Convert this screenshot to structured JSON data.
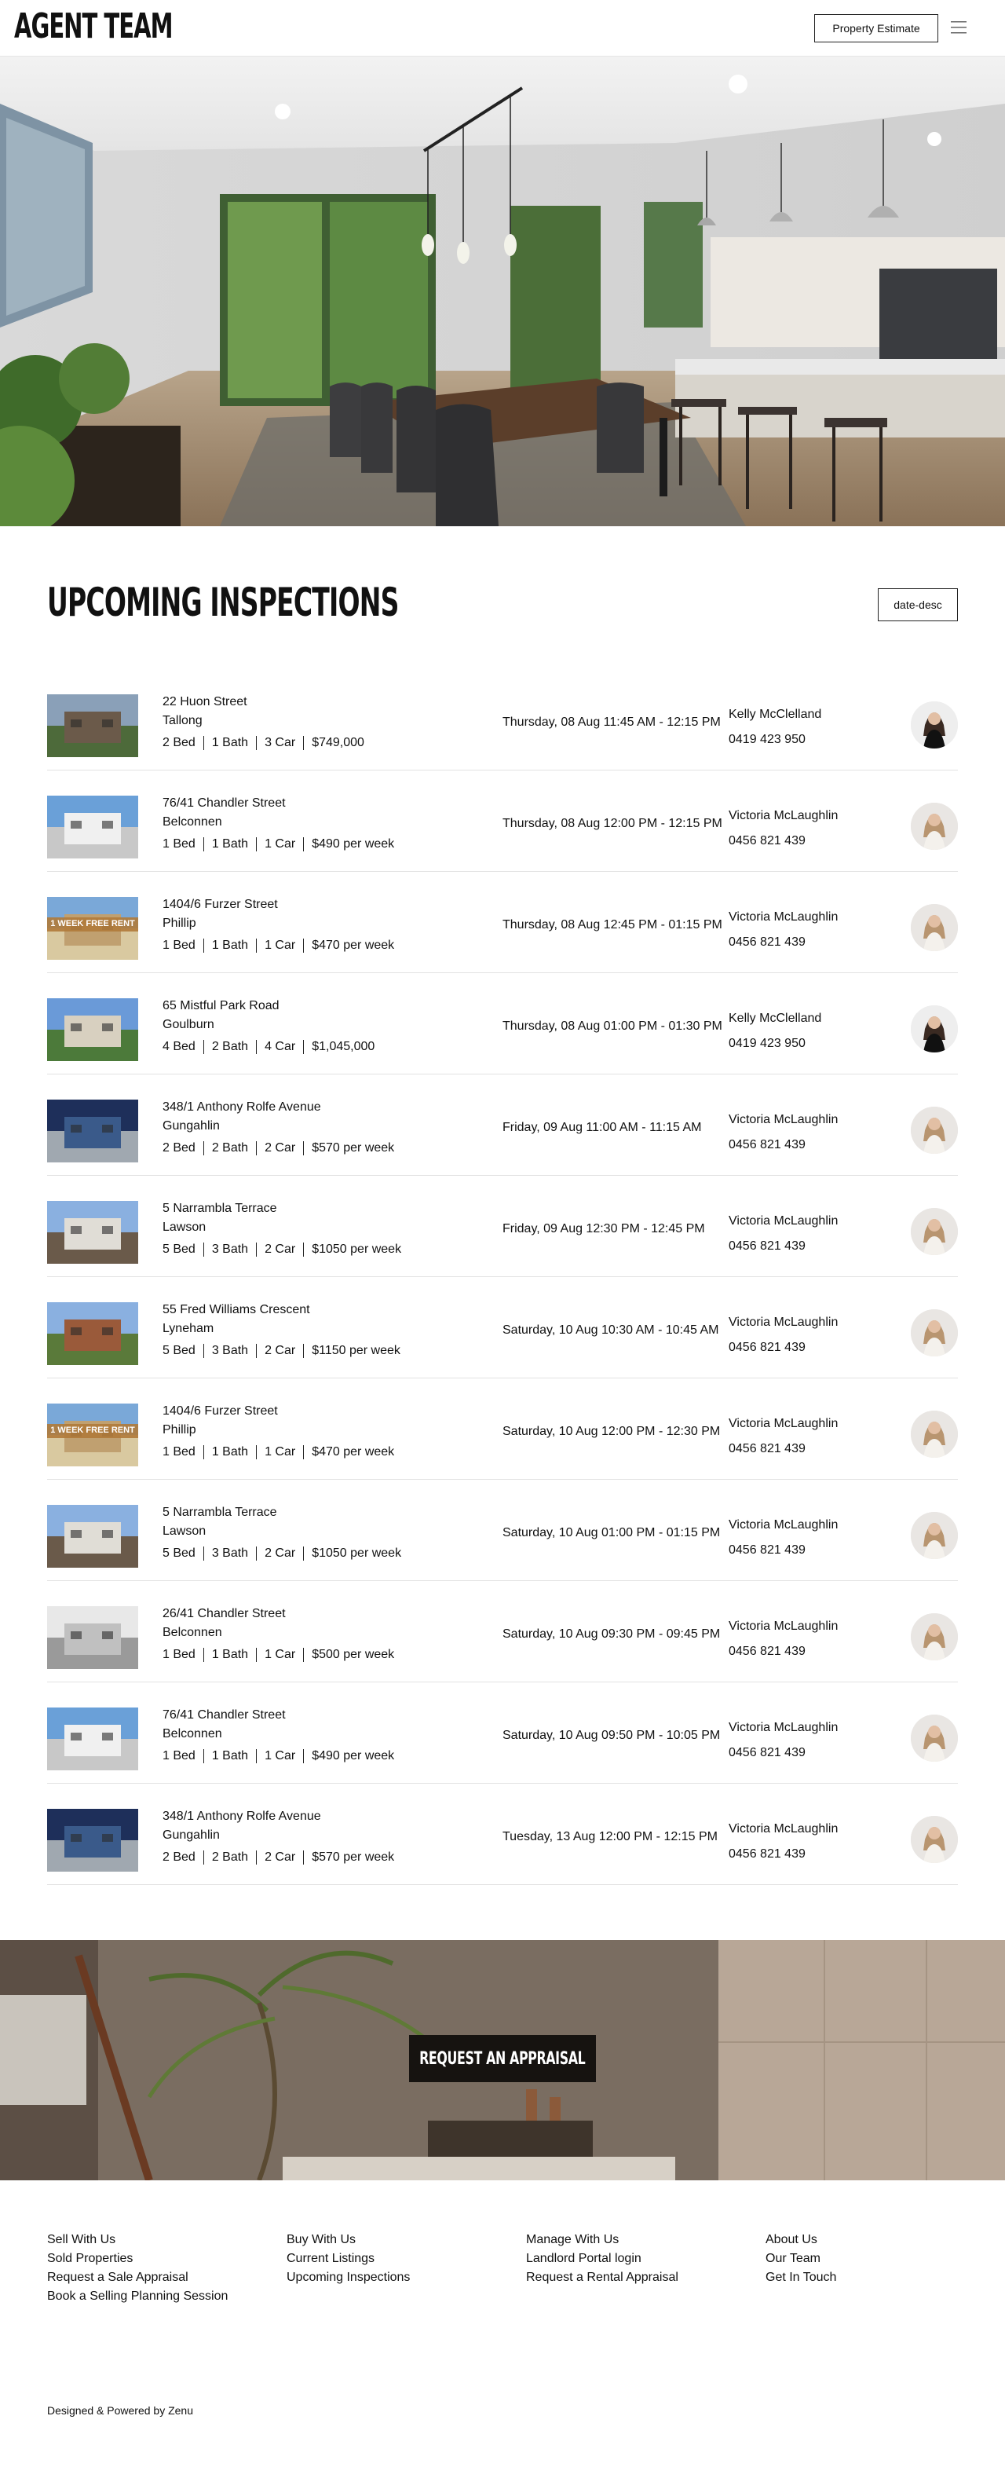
{
  "header": {
    "logo": "AGENT TEAM",
    "estimate_label": "Property Estimate"
  },
  "inspections": {
    "title": "UPCOMING INSPECTIONS",
    "sort_value": "date-desc",
    "rows": [
      {
        "street": "22 Huon Street",
        "suburb": "Tallong",
        "bed": "2 Bed",
        "bath": "1 Bath",
        "car": "3 Car",
        "price": "$749,000",
        "time": "Thursday, 08 Aug 11:45 AM - 12:15 PM",
        "agent": "Kelly McClelland",
        "phone": "0419 423 950"
      },
      {
        "street": "76/41 Chandler Street",
        "suburb": "Belconnen",
        "bed": "1 Bed",
        "bath": "1 Bath",
        "car": "1 Car",
        "price": "$490 per week",
        "time": "Thursday, 08 Aug 12:00 PM - 12:15 PM",
        "agent": "Victoria McLaughlin",
        "phone": "0456 821 439"
      },
      {
        "street": "1404/6 Furzer Street",
        "suburb": "Phillip",
        "bed": "1 Bed",
        "bath": "1 Bath",
        "car": "1 Car",
        "price": "$470 per week",
        "time": "Thursday, 08 Aug 12:45 PM - 01:15 PM",
        "agent": "Victoria McLaughlin",
        "phone": "0456 821 439",
        "banner": "1 WEEK FREE RENT"
      },
      {
        "street": "65 Mistful Park Road",
        "suburb": "Goulburn",
        "bed": "4 Bed",
        "bath": "2 Bath",
        "car": "4 Car",
        "price": "$1,045,000",
        "time": "Thursday, 08 Aug 01:00 PM - 01:30 PM",
        "agent": "Kelly McClelland",
        "phone": "0419 423 950"
      },
      {
        "street": "348/1 Anthony Rolfe Avenue",
        "suburb": "Gungahlin",
        "bed": "2 Bed",
        "bath": "2 Bath",
        "car": "2 Car",
        "price": "$570 per week",
        "time": "Friday, 09 Aug 11:00 AM - 11:15 AM",
        "agent": "Victoria McLaughlin",
        "phone": "0456 821 439"
      },
      {
        "street": "5 Narrambla Terrace",
        "suburb": "Lawson",
        "bed": "5 Bed",
        "bath": "3 Bath",
        "car": "2 Car",
        "price": "$1050 per week",
        "time": "Friday, 09 Aug 12:30 PM - 12:45 PM",
        "agent": "Victoria McLaughlin",
        "phone": "0456 821 439"
      },
      {
        "street": "55 Fred Williams Crescent",
        "suburb": "Lyneham",
        "bed": "5 Bed",
        "bath": "3 Bath",
        "car": "2 Car",
        "price": "$1150 per week",
        "time": "Saturday, 10 Aug 10:30 AM - 10:45 AM",
        "agent": "Victoria McLaughlin",
        "phone": "0456 821 439"
      },
      {
        "street": "1404/6 Furzer Street",
        "suburb": "Phillip",
        "bed": "1 Bed",
        "bath": "1 Bath",
        "car": "1 Car",
        "price": "$470 per week",
        "time": "Saturday, 10 Aug 12:00 PM - 12:30 PM",
        "agent": "Victoria McLaughlin",
        "phone": "0456 821 439",
        "banner": "1 WEEK FREE RENT"
      },
      {
        "street": "5 Narrambla Terrace",
        "suburb": "Lawson",
        "bed": "5 Bed",
        "bath": "3 Bath",
        "car": "2 Car",
        "price": "$1050 per week",
        "time": "Saturday, 10 Aug 01:00 PM - 01:15 PM",
        "agent": "Victoria McLaughlin",
        "phone": "0456 821 439"
      },
      {
        "street": "26/41 Chandler Street",
        "suburb": "Belconnen",
        "bed": "1 Bed",
        "bath": "1 Bath",
        "car": "1 Car",
        "price": "$500 per week",
        "time": "Saturday, 10 Aug 09:30 PM - 09:45 PM",
        "agent": "Victoria McLaughlin",
        "phone": "0456 821 439"
      },
      {
        "street": "76/41 Chandler Street",
        "suburb": "Belconnen",
        "bed": "1 Bed",
        "bath": "1 Bath",
        "car": "1 Car",
        "price": "$490 per week",
        "time": "Saturday, 10 Aug 09:50 PM - 10:05 PM",
        "agent": "Victoria McLaughlin",
        "phone": "0456 821 439"
      },
      {
        "street": "348/1 Anthony Rolfe Avenue",
        "suburb": "Gungahlin",
        "bed": "2 Bed",
        "bath": "2 Bath",
        "car": "2 Car",
        "price": "$570 per week",
        "time": "Tuesday, 13 Aug 12:00 PM - 12:15 PM",
        "agent": "Victoria McLaughlin",
        "phone": "0456 821 439"
      }
    ]
  },
  "cta": {
    "label": "REQUEST AN APPRAISAL"
  },
  "footer": {
    "col1": [
      "Sell With Us",
      "Sold Properties",
      "Request a Sale Appraisal",
      "Book a Selling Planning Session"
    ],
    "col2": [
      "Buy With Us",
      "Current Listings",
      "Upcoming Inspections"
    ],
    "col3": [
      "Manage With Us",
      "Landlord Portal login",
      "Request a Rental Appraisal"
    ],
    "col4": [
      "About Us",
      "Our Team",
      "Get In Touch"
    ],
    "credit": "Designed & Powered by Zenu"
  }
}
